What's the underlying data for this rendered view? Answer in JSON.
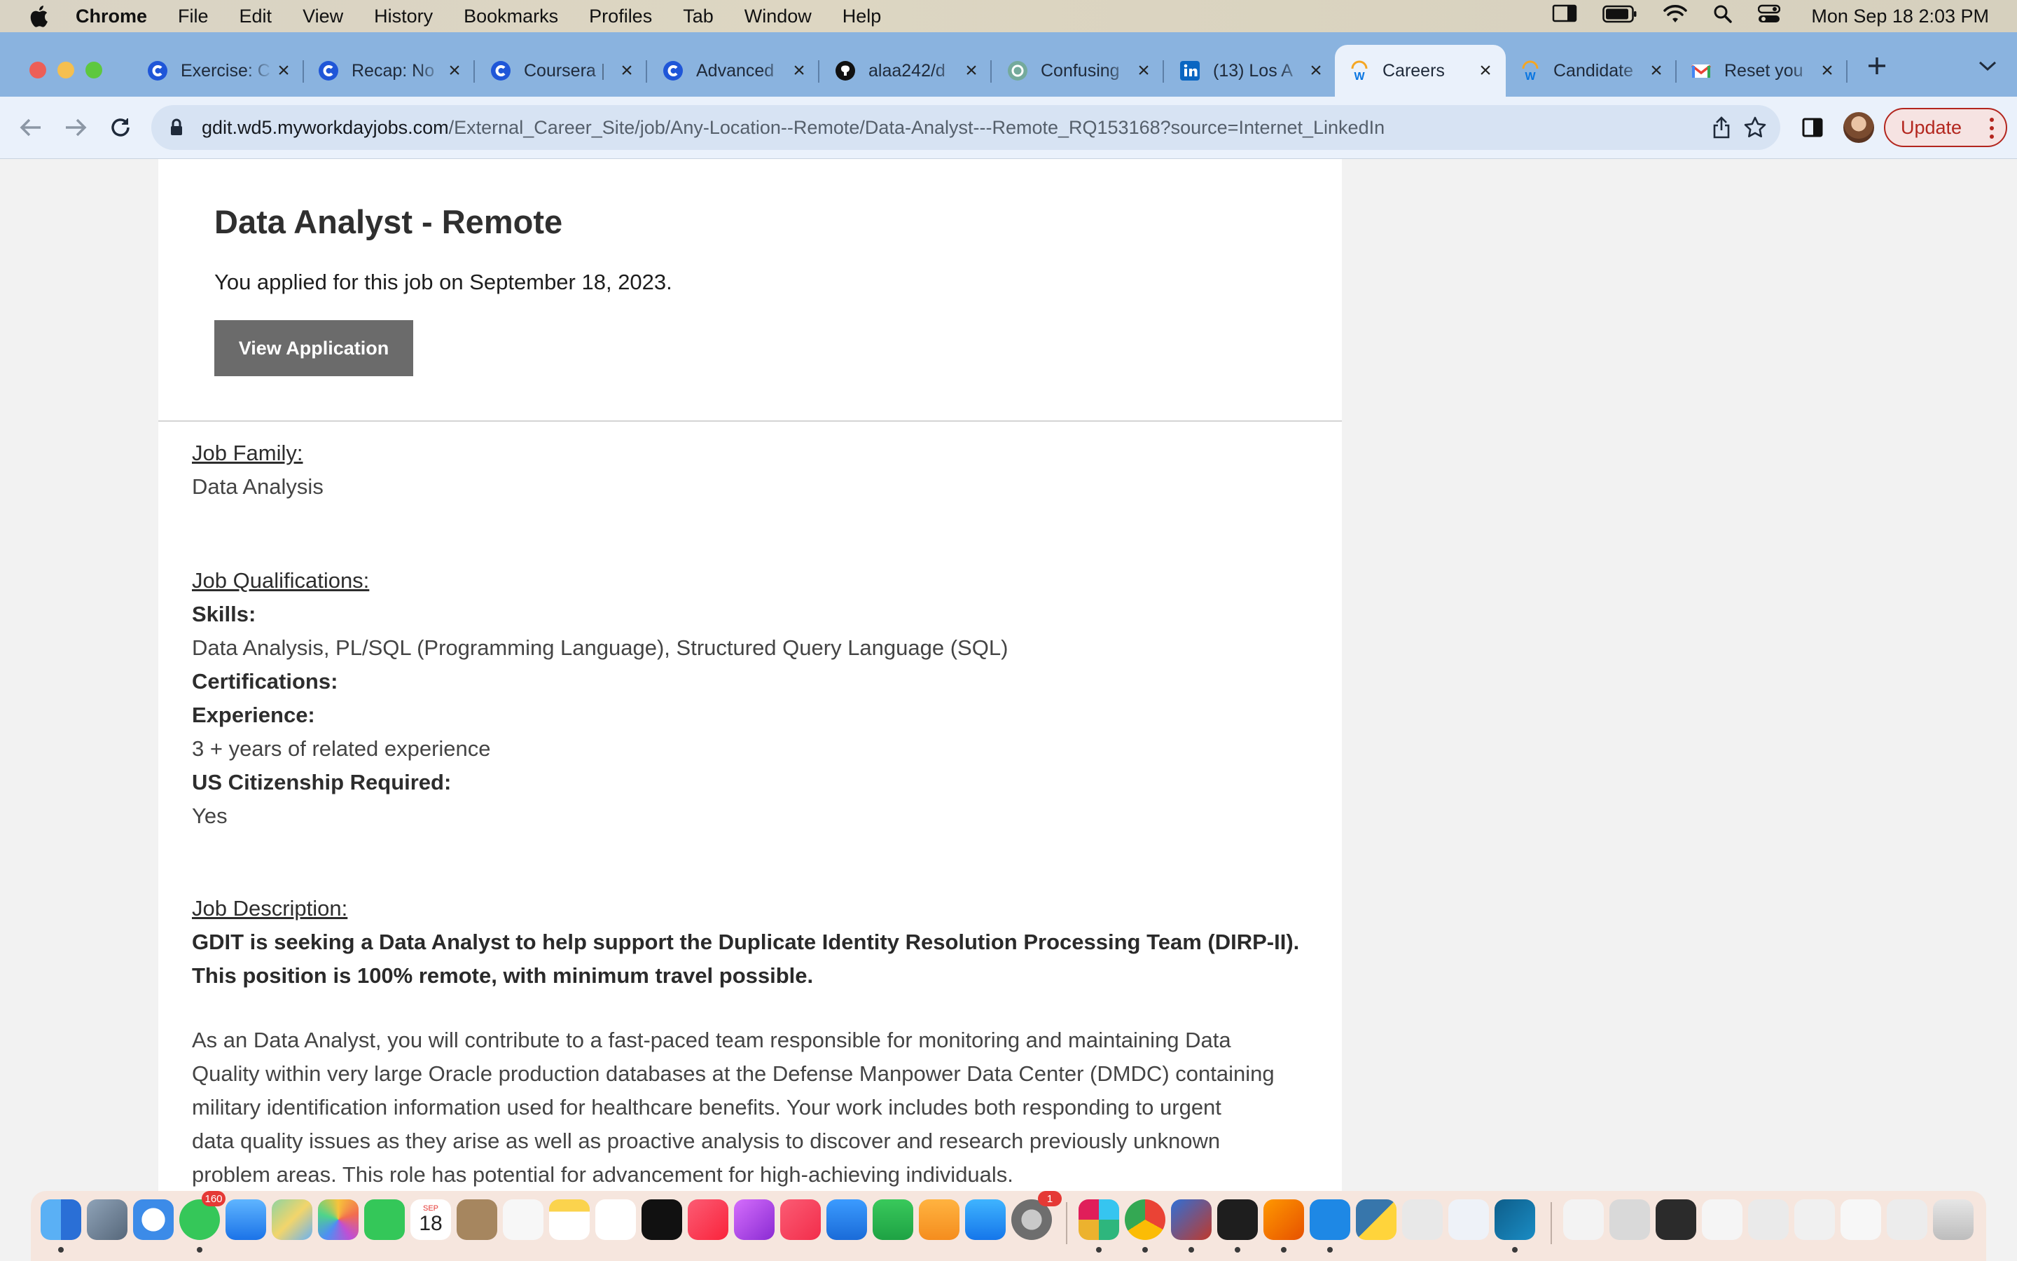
{
  "menubar": {
    "app": "Chrome",
    "items": [
      "File",
      "Edit",
      "View",
      "History",
      "Bookmarks",
      "Profiles",
      "Tab",
      "Window",
      "Help"
    ],
    "clock": "Mon Sep 18  2:03 PM"
  },
  "tabs": [
    {
      "title": "Exercise: C",
      "icon": "coursera-icon"
    },
    {
      "title": "Recap: No",
      "icon": "coursera-icon"
    },
    {
      "title": "Coursera |",
      "icon": "coursera-icon"
    },
    {
      "title": "Advanced",
      "icon": "coursera-icon"
    },
    {
      "title": "alaa242/d",
      "icon": "github-icon"
    },
    {
      "title": "Confusing",
      "icon": "openai-icon"
    },
    {
      "title": "(13) Los A",
      "icon": "linkedin-icon"
    },
    {
      "title": "Careers",
      "icon": "workday-icon",
      "active": true
    },
    {
      "title": "Candidate",
      "icon": "workday-icon"
    },
    {
      "title": "Reset you",
      "icon": "gmail-icon"
    }
  ],
  "address_bar": {
    "host": "gdit.wd5.myworkdayjobs.com",
    "path": "/External_Career_Site/job/Any-Location--Remote/Data-Analyst---Remote_RQ153168?source=Internet_LinkedIn"
  },
  "toolbar": {
    "update_label": "Update"
  },
  "job": {
    "title": "Data Analyst - Remote",
    "applied_text": "You applied for this job on September 18, 2023.",
    "view_button": "View Application",
    "family_label": "Job Family:",
    "family_value": "Data Analysis",
    "qualifications_label": "Job Qualifications:",
    "skills_label": "Skills:",
    "skills_value": "Data Analysis, PL/SQL (Programming Language), Structured Query Language (SQL)",
    "certifications_label": "Certifications:",
    "experience_label": "Experience:",
    "experience_value": "3 + years of related experience",
    "citizenship_label": "US Citizenship Required:",
    "citizenship_value": "Yes",
    "description_label": "Job Description:",
    "description_intro": [
      "GDIT is seeking a Data Analyst to help support the Duplicate Identity Resolution Processing Team (DIRP-II).",
      "This position is 100% remote, with minimum travel possible."
    ],
    "description_body": [
      "As an Data Analyst, you will contribute to a fast-paced team responsible for monitoring and maintaining Data",
      "Quality within very large Oracle production databases at the Defense Manpower Data Center (DMDC) containing",
      "military identification information used for healthcare benefits. Your work includes both responding to urgent",
      "data quality issues as they arise as well as proactive analysis to discover and research previously unknown",
      "problem areas. This role has potential for advancement for high-achieving individuals."
    ]
  },
  "dock": {
    "calendar_month": "SEP",
    "calendar_day": "18",
    "messages_badge": "160",
    "settings_badge": "1"
  }
}
